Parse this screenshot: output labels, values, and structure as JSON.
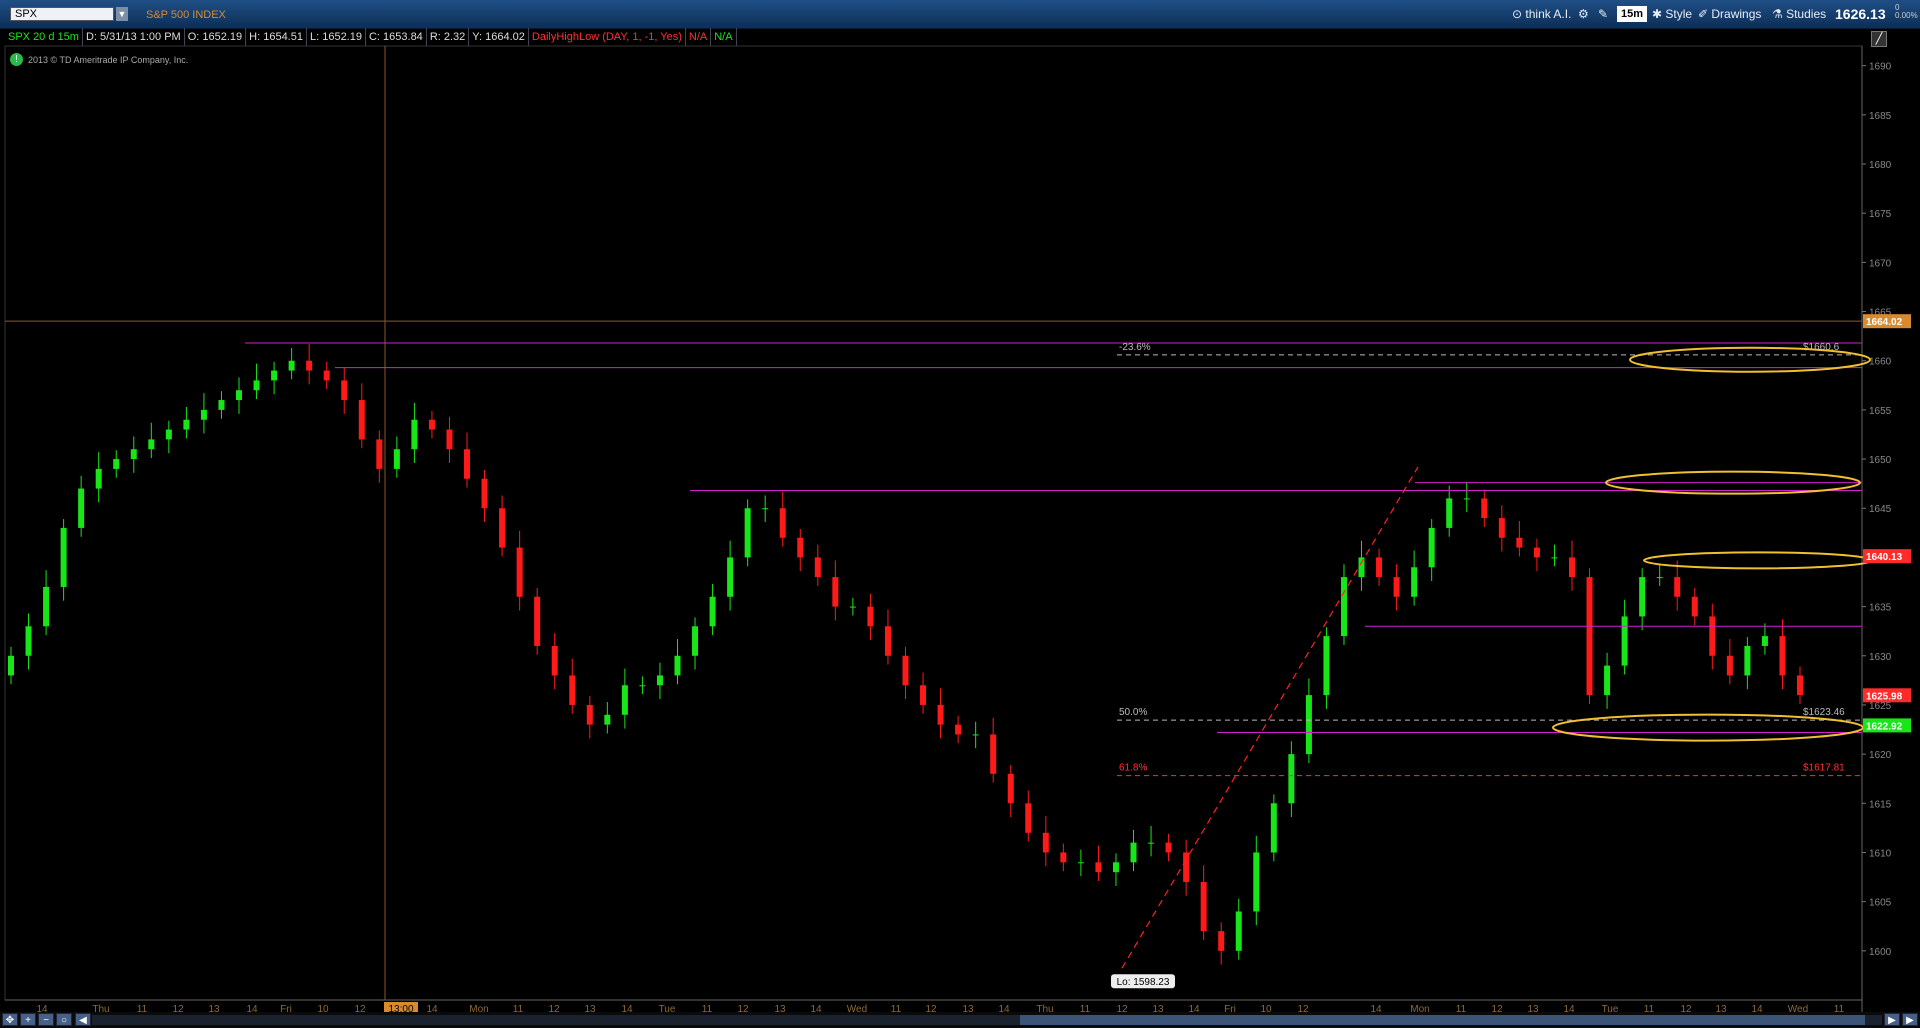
{
  "header": {
    "symbol": "SPX",
    "description": "S&P 500 INDEX",
    "buttons": {
      "think": "think A.I.",
      "timeframe": "15m",
      "style": "Style",
      "drawings": "Drawings",
      "studies": "Studies"
    },
    "last_price": "1626.13",
    "pct_change": "0",
    "pct_change2": "0.00%"
  },
  "infobar": {
    "label": "SPX 20 d 15m",
    "date": "D: 5/31/13 1:00 PM",
    "open": "O: 1652.19",
    "high": "H: 1654.51",
    "low": "L: 1652.19",
    "close": "C: 1653.84",
    "range": "R: 2.32",
    "y": "Y: 1664.02",
    "study": "DailyHighLow (DAY, 1, -1, Yes)",
    "na1": "N/A",
    "na2": "N/A"
  },
  "copyright": "2013 © TD Ameritrade IP Company, Inc.",
  "chart_data": {
    "type": "candlestick",
    "ylim": [
      1595,
      1692
    ],
    "yticks": [
      1600,
      1605,
      1610,
      1615,
      1620,
      1625,
      1630,
      1635,
      1640,
      1645,
      1650,
      1655,
      1660,
      1665,
      1670,
      1675,
      1680,
      1685,
      1690
    ],
    "xticks": [
      "14",
      "Thu",
      "11",
      "12",
      "13",
      "14",
      "Fri",
      "10",
      "12",
      "13:00",
      "14",
      "Mon",
      "11",
      "12",
      "13",
      "14",
      "Tue",
      "11",
      "12",
      "13",
      "14",
      "Wed",
      "11",
      "12",
      "13",
      "14",
      "Thu",
      "11",
      "12",
      "13",
      "14",
      "Fri",
      "10",
      "12",
      "14",
      "Mon",
      "11",
      "12",
      "13",
      "14",
      "Tue",
      "11",
      "12",
      "13",
      "14",
      "Wed",
      "11"
    ],
    "price_tags": [
      {
        "label": "1664.02",
        "value": 1664.02,
        "color": "#d98a2e"
      },
      {
        "label": "1640.13",
        "value": 1640.13,
        "color": "#ff2a2a"
      },
      {
        "label": "1625.98",
        "value": 1625.98,
        "color": "#ff2a2a"
      },
      {
        "label": "1622.92",
        "value": 1622.92,
        "color": "#19e619"
      }
    ],
    "fib_levels": [
      {
        "label": "-23.6%",
        "price_label": "$1660.6",
        "value": 1660.6,
        "color": "#bbbbbb"
      },
      {
        "label": "50.0%",
        "price_label": "$1623.46",
        "value": 1623.46,
        "color": "#bbbbbb"
      },
      {
        "label": "61.8%",
        "price_label": "$1617.81",
        "value": 1617.81,
        "color": "#ff3030"
      }
    ],
    "low_label": "Lo: 1598.23",
    "low_value": 1598.23,
    "cursor_time": "13:00",
    "cursor_price": 1664.02,
    "horizontal_lines": [
      {
        "value": 1661.8
      },
      {
        "value": 1659.3
      },
      {
        "value": 1646.8
      },
      {
        "value": 1633.0
      },
      {
        "value": 1622.2
      },
      {
        "value": 1647.6
      }
    ],
    "close_path": [
      1630,
      1633,
      1637,
      1643,
      1647,
      1649,
      1650,
      1651,
      1652,
      1653,
      1654,
      1655,
      1656,
      1657,
      1658,
      1659,
      1660,
      1659,
      1658,
      1656,
      1652,
      1649,
      1651,
      1654,
      1653,
      1651,
      1648,
      1645,
      1641,
      1636,
      1631,
      1628,
      1625,
      1623,
      1624,
      1627,
      1627,
      1628,
      1630,
      1633,
      1636,
      1640,
      1645,
      1645,
      1642,
      1640,
      1638,
      1635,
      1635,
      1633,
      1630,
      1627,
      1625,
      1623,
      1622,
      1622,
      1618,
      1615,
      1612,
      1610,
      1609,
      1609,
      1608,
      1609,
      1611,
      1611,
      1610,
      1607,
      1602,
      1600,
      1604,
      1610,
      1615,
      1620,
      1626,
      1632,
      1638,
      1640,
      1638,
      1636,
      1639,
      1643,
      1646,
      1646,
      1644,
      1642,
      1641,
      1640,
      1640,
      1638,
      1626,
      1629,
      1634,
      1638,
      1638,
      1636,
      1634,
      1630,
      1628,
      1631,
      1632,
      1628,
      1626
    ]
  }
}
